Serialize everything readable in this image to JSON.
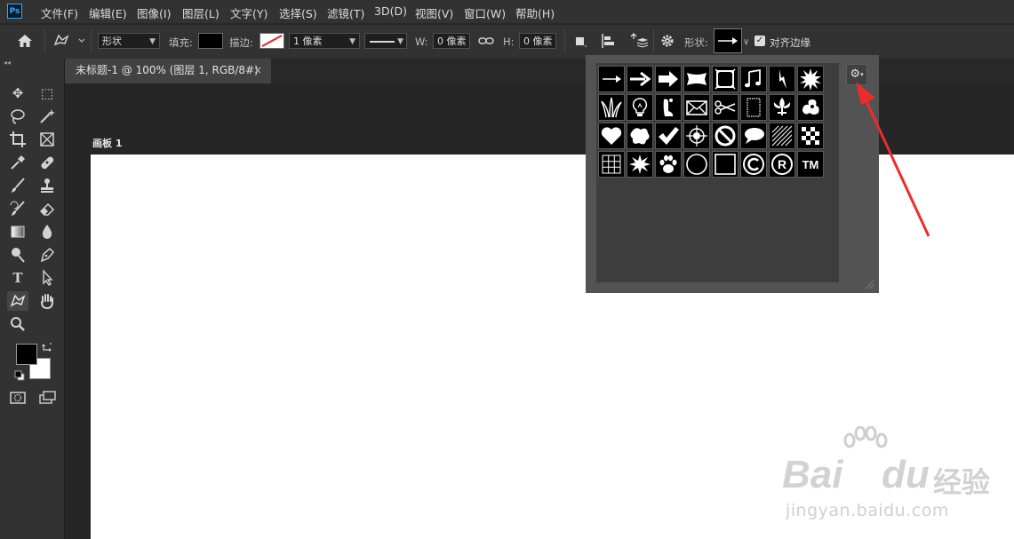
{
  "app": {
    "logo": "Ps"
  },
  "menu": [
    "文件(F)",
    "编辑(E)",
    "图像(I)",
    "图层(L)",
    "文字(Y)",
    "选择(S)",
    "滤镜(T)",
    "3D(D)",
    "视图(V)",
    "窗口(W)",
    "帮助(H)"
  ],
  "options": {
    "mode": "形状",
    "fill_label": "填充:",
    "stroke_label": "描边:",
    "stroke_width": "1 像素",
    "w_label": "W:",
    "w_value": "0 像素",
    "h_label": "H:",
    "h_value": "0 像素",
    "shape_label": "形状:",
    "align_edges": "对齐边缘",
    "align_checked": true
  },
  "document": {
    "tab_title": "未标题-1 @ 100% (图层 1, RGB/8#)",
    "close": "×",
    "artboard_label": "画板 1"
  },
  "shapes": [
    "arrow-thin",
    "arrow-medium",
    "arrow-bold",
    "banner",
    "frame",
    "music-note",
    "lightning",
    "starburst",
    "grass",
    "lightbulb",
    "foot",
    "envelope",
    "scissors",
    "stamp",
    "fleur-de-lis",
    "ornament",
    "heart",
    "blob",
    "checkmark",
    "target",
    "no-sign",
    "speech-bubble",
    "hatch",
    "checker",
    "grid",
    "burst",
    "paw",
    "circle",
    "square",
    "copyright",
    "registered",
    "trademark"
  ],
  "colors": {
    "accent": "#31a8ff",
    "annotation": "#ee2b2b",
    "panel": "#535353",
    "canvas": "#ffffff"
  },
  "watermark": {
    "brand_a": "Bai",
    "brand_b": "du",
    "brand_cn": "经验",
    "url": "jingyan.baidu.com"
  }
}
